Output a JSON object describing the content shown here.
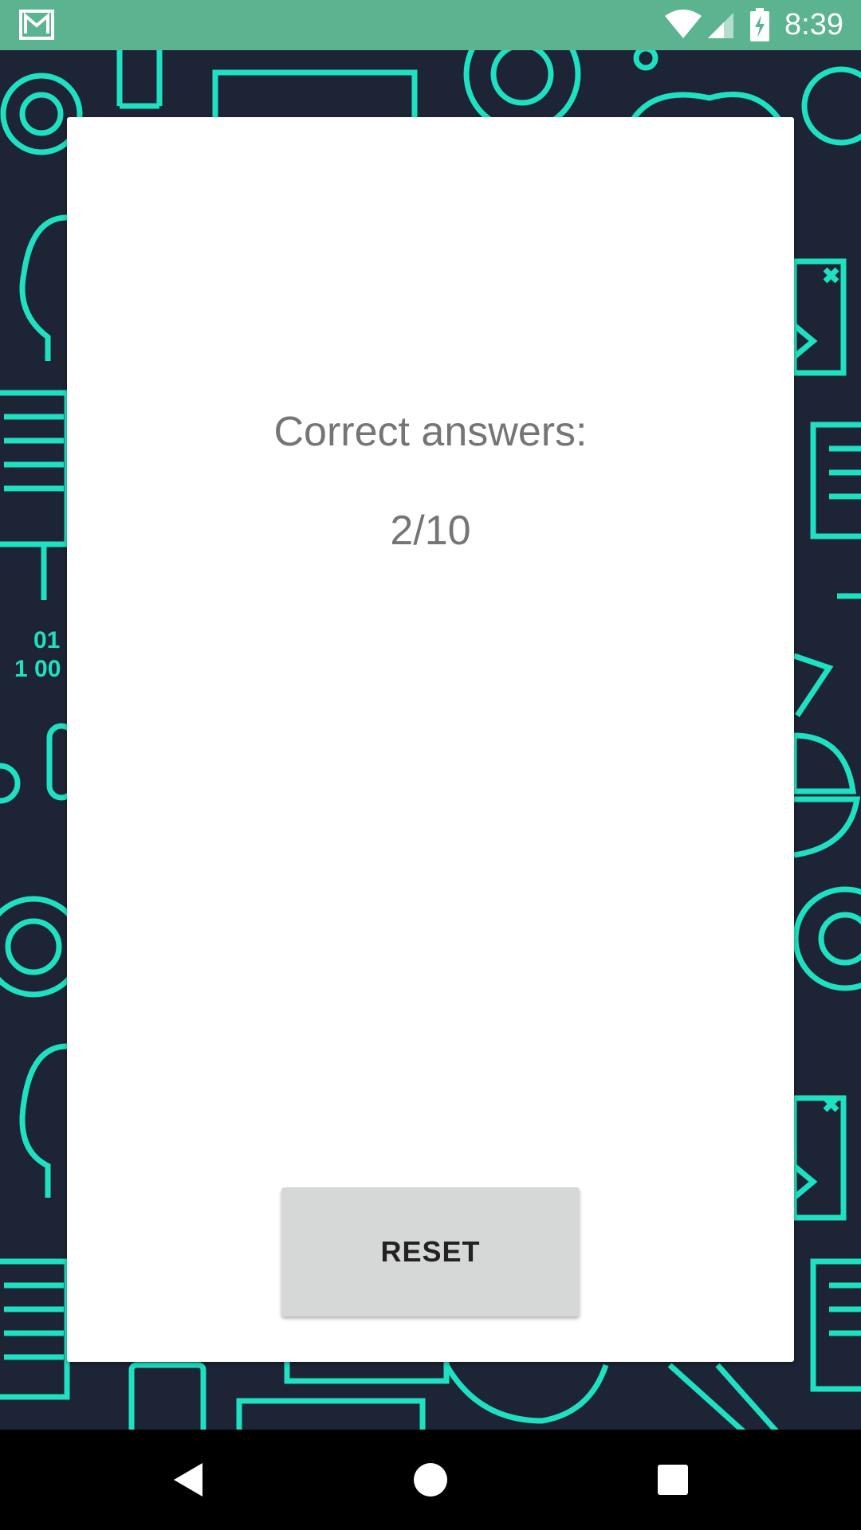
{
  "status_bar": {
    "time": "8:39",
    "notification_icon": "gmail-icon",
    "icons": [
      "wifi-icon",
      "signal-icon",
      "battery-charging-icon"
    ]
  },
  "background": {
    "pattern": "tech-icons-wallpaper",
    "base_color": "#1c2436",
    "line_color": "#1fe0c0",
    "visible_text": [
      "01",
      "1 00"
    ]
  },
  "result": {
    "label": "Correct answers:",
    "score": "2/10"
  },
  "reset_button": {
    "label": "RESET"
  },
  "nav_bar": {
    "back_icon": "back-icon",
    "home_icon": "home-icon",
    "recents_icon": "recents-icon"
  },
  "colors": {
    "status_bar": "#5cb390",
    "card": "#ffffff",
    "text": "#757575",
    "button": "#d6d7d7",
    "nav_bar": "#000000"
  }
}
